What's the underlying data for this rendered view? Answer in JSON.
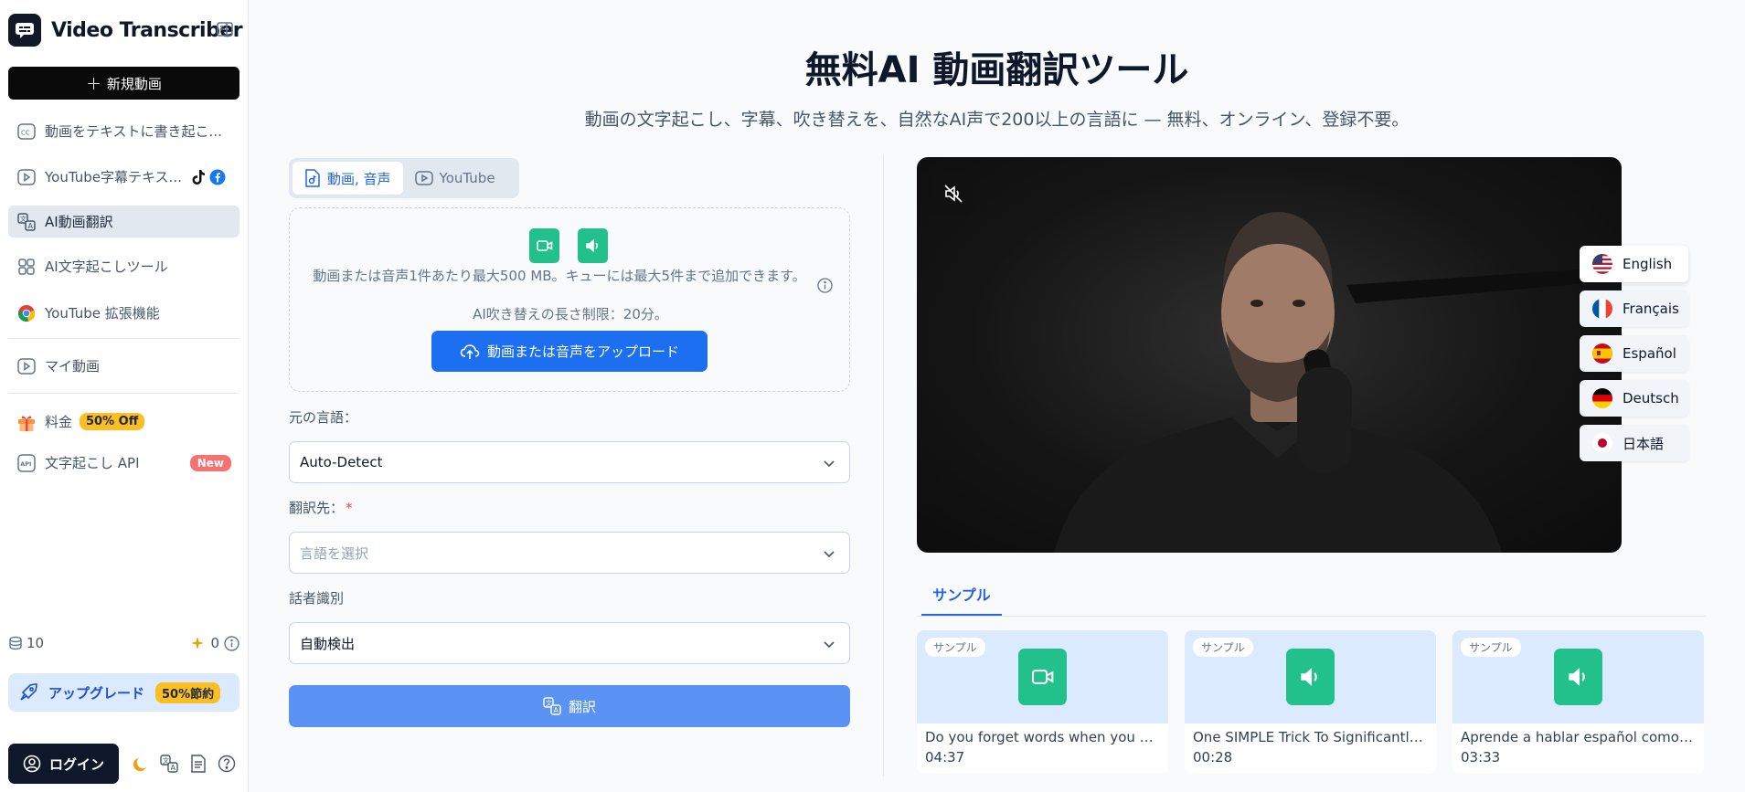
{
  "sidebar": {
    "brand": "Video Transcriber",
    "new_button": "新規動画",
    "items": [
      {
        "label": "動画をテキストに書き起こ..."
      },
      {
        "label": "YouTube字幕テキス..."
      },
      {
        "label": "AI動画翻訳"
      },
      {
        "label": "AI文字起こしツール"
      },
      {
        "label": "YouTube 拡張機能"
      },
      {
        "label": "マイ動画"
      },
      {
        "label": "料金",
        "badge": "50% Off"
      },
      {
        "label": "文字起こし API",
        "badge": "New"
      }
    ],
    "credits_left": "10",
    "credits_right": "0",
    "upgrade_label": "アップグレード",
    "upgrade_badge": "50%節約",
    "login_label": "ログイン"
  },
  "main": {
    "title": "無料AI 動画翻訳ツール",
    "subtitle": "動画の文字起こし、字幕、吹き替えを、自然なAI声で200以上の言語に — 無料、オンライン、登録不要。",
    "tabs": [
      {
        "label": "動画, 音声"
      },
      {
        "label": "YouTube"
      }
    ],
    "dropzone_text": "動画または音声1件あたり最大500 MB。キューには最大5件まで追加できます。",
    "dropzone_limit": "AI吹き替えの長さ制限：20分。",
    "upload_button": "動画または音声をアップロード",
    "source_label": "元の言語：",
    "source_value": "Auto-Detect",
    "target_label": "翻訳先：",
    "target_required": "*",
    "target_placeholder": "言語を選択",
    "speaker_label": "話者識別",
    "speaker_value": "自動検出",
    "translate_button": "翻訳"
  },
  "preview": {
    "languages": [
      {
        "label": "English"
      },
      {
        "label": "Français"
      },
      {
        "label": "Español"
      },
      {
        "label": "Deutsch"
      },
      {
        "label": "日本語"
      }
    ]
  },
  "samples": {
    "tab_label": "サンプル",
    "cards": [
      {
        "badge": "サンプル",
        "title": "Do you forget words when you spe...",
        "duration": "04:37",
        "kind": "video"
      },
      {
        "badge": "サンプル",
        "title": "One SIMPLE Trick To Significantly I...",
        "duration": "00:28",
        "kind": "audio"
      },
      {
        "badge": "サンプル",
        "title": "Aprende a hablar español como un...",
        "duration": "03:33",
        "kind": "audio"
      }
    ]
  },
  "colors": {
    "accent": "#1d6ff2",
    "file_icon": "#22c08a",
    "badge": "#fbbf24",
    "new_badge": "#f87171"
  }
}
